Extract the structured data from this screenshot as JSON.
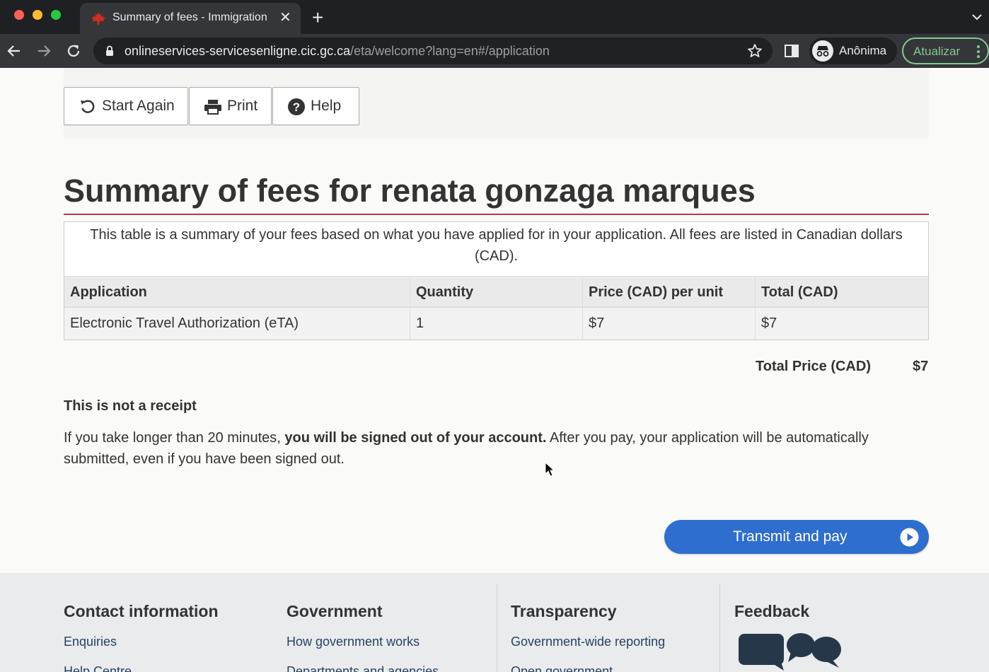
{
  "browser": {
    "tab_title": "Summary of fees - Immigration",
    "url_host": "onlineservices-servicesenligne.cic.gc.ca",
    "url_path": "/eta/welcome?lang=en#/application",
    "profile_label": "Anônima",
    "update_label": "Atualizar"
  },
  "toolbar": {
    "start_again": "Start Again",
    "print": "Print",
    "help": "Help"
  },
  "page": {
    "title": "Summary of fees for renata gonzaga marques",
    "table_caption": "This table is a summary of your fees based on what you have applied for in your application. All fees are listed in Canadian dollars (CAD).",
    "columns": [
      "Application",
      "Quantity",
      "Price (CAD) per unit",
      "Total (CAD)"
    ],
    "rows": [
      [
        "Electronic Travel Authorization (eTA)",
        "1",
        "$7",
        "$7"
      ]
    ],
    "total_label": "Total Price (CAD)",
    "total_value": "$7",
    "receipt_heading": "This is not a receipt",
    "notice_before": "If you take longer than 20 minutes, ",
    "notice_bold": "you will be signed out of your account.",
    "notice_after": " After you pay, your application will be automatically submitted, even if you have been signed out.",
    "transmit_button": "Transmit and pay"
  },
  "footer": {
    "columns": [
      {
        "heading": "Contact information",
        "links": [
          "Enquiries",
          "Help Centre"
        ]
      },
      {
        "heading": "Government",
        "links": [
          "How government works",
          "Departments and agencies"
        ]
      },
      {
        "heading": "Transparency",
        "links": [
          "Government-wide reporting",
          "Open government"
        ]
      },
      {
        "heading": "Feedback",
        "links": []
      }
    ]
  },
  "colors": {
    "title_rule": "#af3c43",
    "primary_button": "#2e6ecf",
    "footer_link": "#284162",
    "update_green": "#81c995"
  },
  "icons": [
    "maple-leaf-icon",
    "close-icon",
    "plus-icon",
    "chevron-down-icon",
    "back-arrow-icon",
    "forward-arrow-icon",
    "reload-icon",
    "lock-icon",
    "star-icon",
    "side-panel-icon",
    "incognito-icon",
    "kebab-menu-icon",
    "refresh-icon",
    "printer-icon",
    "question-circle-icon",
    "play-circle-icon",
    "speech-bubbles-icon",
    "mouse-cursor-icon"
  ]
}
